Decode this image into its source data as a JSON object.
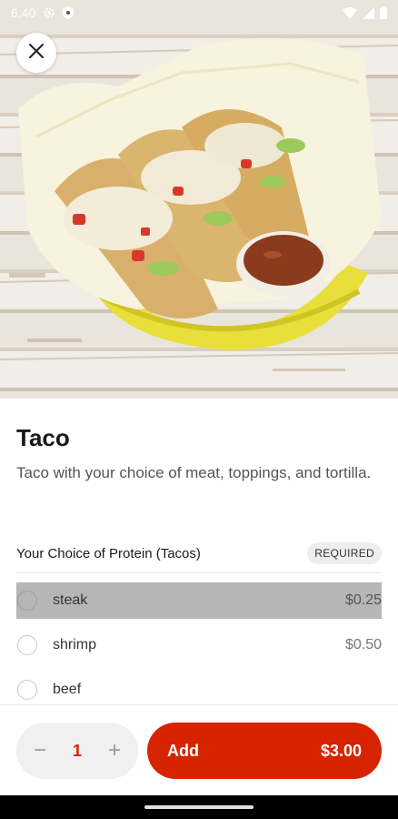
{
  "status_bar": {
    "time": "6:40",
    "left_icons": [
      "gear-icon",
      "shield-icon"
    ],
    "right_icons": [
      "wifi-icon",
      "signal-icon",
      "battery-icon"
    ]
  },
  "close_icon": "close-icon",
  "item": {
    "title": "Taco",
    "description": "Taco with your choice of meat, toppings, and tortilla."
  },
  "section": {
    "title": "Your Choice of Protein (Tacos)",
    "badge": "REQUIRED",
    "options": [
      {
        "label": "steak",
        "price": "$0.25",
        "highlighted": true
      },
      {
        "label": "shrimp",
        "price": "$0.50",
        "highlighted": false
      },
      {
        "label": "beef",
        "price": "",
        "highlighted": false
      }
    ]
  },
  "bottom": {
    "minus": "−",
    "quantity": "1",
    "plus": "+",
    "add_label": "Add",
    "add_price": "$3.00"
  },
  "colors": {
    "accent": "#d62300",
    "highlight_row": "#b6b6b6"
  }
}
